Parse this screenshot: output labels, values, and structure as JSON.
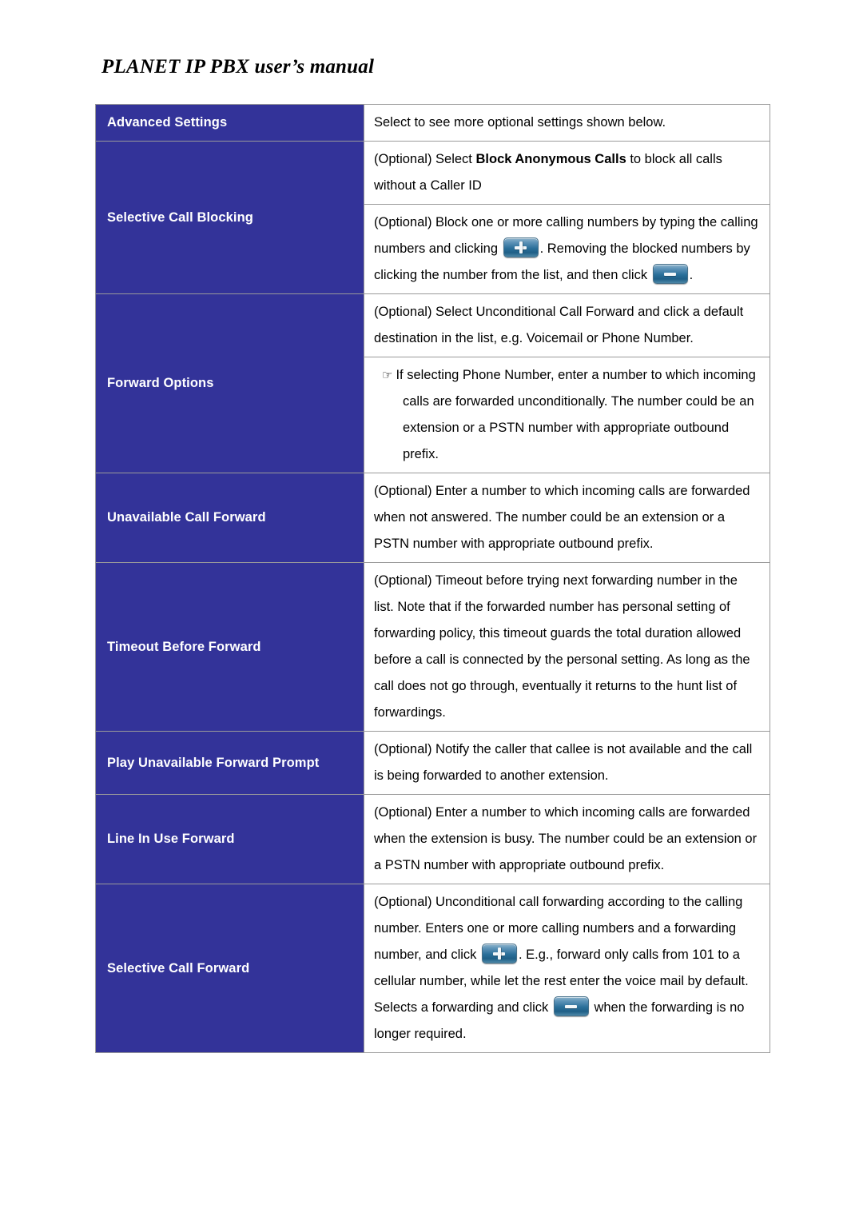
{
  "header": {
    "title": "PLANET IP PBX user’s manual"
  },
  "colors": {
    "label_cell_background": "#333399",
    "label_cell_text": "#ffffff",
    "table_border": "#9a9a9a",
    "page_background": "#ffffff",
    "button_blue": "#2a6f99"
  },
  "icons": {
    "add_button": "plus-button-icon",
    "remove_button": "minus-button-icon",
    "bullet_hand": "☞"
  },
  "table": {
    "rows": [
      {
        "label": "Advanced Settings",
        "paragraphs": [
          {
            "type": "plain",
            "text": "Select to see more optional settings shown below."
          }
        ]
      },
      {
        "label": "Selective Call Blocking",
        "paragraphs": [
          {
            "type": "rich",
            "segments": [
              {
                "kind": "text",
                "text": "(Optional) Select "
              },
              {
                "kind": "bold",
                "text": "Block Anonymous Calls"
              },
              {
                "kind": "text",
                "text": " to block all calls without a Caller ID"
              }
            ]
          },
          {
            "type": "rich",
            "segments": [
              {
                "kind": "text",
                "text": "(Optional) Block one or more calling numbers by typing the calling numbers and clicking "
              },
              {
                "kind": "button",
                "icon": "plus-button-icon"
              },
              {
                "kind": "text",
                "text": ". Removing the blocked numbers by clicking the number from the list, and then click "
              },
              {
                "kind": "button",
                "icon": "minus-button-icon"
              },
              {
                "kind": "text",
                "text": "."
              }
            ]
          }
        ]
      },
      {
        "label": "Forward Options",
        "paragraphs": [
          {
            "type": "plain",
            "text": "(Optional) Select Unconditional Call Forward and click a default destination in the list, e.g. Voicemail or Phone Number."
          },
          {
            "type": "hanging",
            "bullet": "☞",
            "text": "If selecting Phone Number, enter a number to which incoming calls are forwarded unconditionally. The number could be an extension or a PSTN number with appropriate outbound prefix."
          }
        ]
      },
      {
        "label": "Unavailable Call Forward",
        "paragraphs": [
          {
            "type": "plain",
            "text": "(Optional) Enter a number to which incoming calls are forwarded when not answered. The number could be an extension or a PSTN number with appropriate outbound prefix."
          }
        ]
      },
      {
        "label": "Timeout Before Forward",
        "paragraphs": [
          {
            "type": "plain",
            "text": "(Optional) Timeout before trying next forwarding number in the list. Note that if the forwarded number has personal setting of forwarding policy, this timeout guards the total duration allowed before a call is connected by the personal setting. As long as the call does not go through, eventually it returns to the hunt list of forwardings."
          }
        ]
      },
      {
        "label": "Play Unavailable Forward Prompt",
        "paragraphs": [
          {
            "type": "plain",
            "text": "(Optional) Notify the caller that callee is not available and the call is being forwarded to another extension."
          }
        ]
      },
      {
        "label": "Line In Use Forward",
        "paragraphs": [
          {
            "type": "plain",
            "text": "(Optional) Enter a number to which incoming calls are forwarded when the extension is busy. The number could be an extension or a PSTN number with appropriate outbound prefix."
          }
        ]
      },
      {
        "label": "Selective Call Forward",
        "paragraphs": [
          {
            "type": "rich",
            "segments": [
              {
                "kind": "text",
                "text": "(Optional) Unconditional call forwarding according to the calling number. Enters one or more calling numbers and a forwarding number, and click "
              },
              {
                "kind": "button",
                "icon": "plus-button-icon"
              },
              {
                "kind": "text",
                "text": ". E.g., forward only calls from 101 to a cellular number, while let the rest enter the voice mail by default. Selects a forwarding and click "
              },
              {
                "kind": "button",
                "icon": "minus-button-icon"
              },
              {
                "kind": "text",
                "text": " when the forwarding is no longer required."
              }
            ]
          }
        ]
      }
    ]
  }
}
